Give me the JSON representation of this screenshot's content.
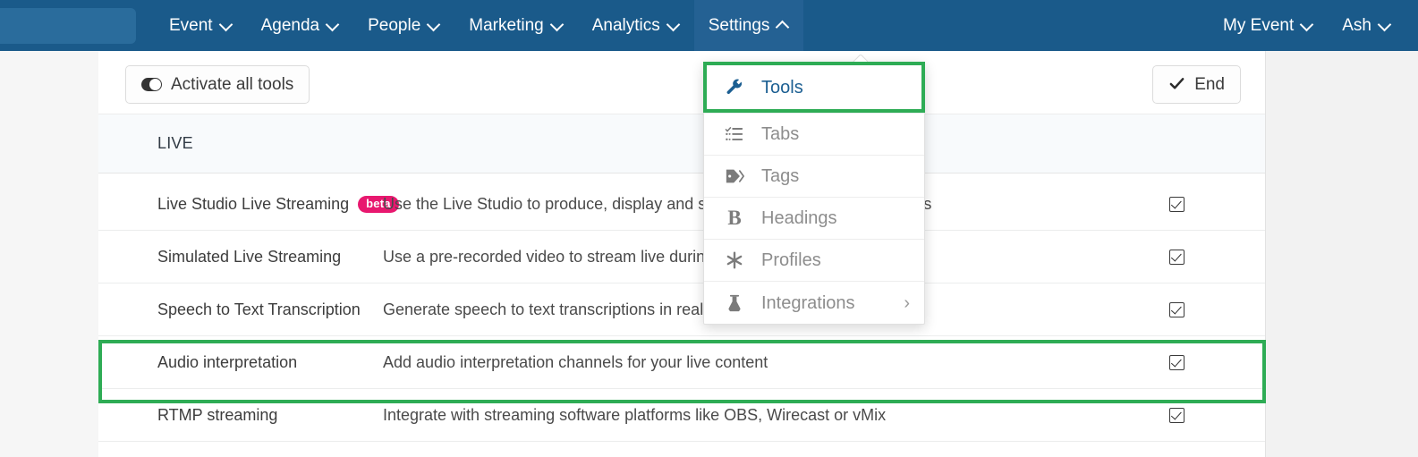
{
  "navbar": {
    "search_placeholder": "",
    "items": [
      {
        "label": "Event",
        "icon": "chevron-down-icon",
        "active": false
      },
      {
        "label": "Agenda",
        "icon": "chevron-down-icon",
        "active": false
      },
      {
        "label": "People",
        "icon": "chevron-down-icon",
        "active": false
      },
      {
        "label": "Marketing",
        "icon": "chevron-down-icon",
        "active": false
      },
      {
        "label": "Analytics",
        "icon": "chevron-down-icon",
        "active": false
      },
      {
        "label": "Settings",
        "icon": "chevron-up-icon",
        "active": true
      }
    ],
    "right_items": [
      {
        "label": "My Event",
        "icon": "chevron-down-icon"
      },
      {
        "label": "Ash",
        "icon": "chevron-down-icon"
      }
    ],
    "background_color": "#1a5a8a",
    "active_tab_color": "#246193"
  },
  "dropdown": {
    "items": [
      {
        "label": "Tools",
        "icon": "wrench-icon",
        "highlighted": true,
        "has_submenu": false
      },
      {
        "label": "Tabs",
        "icon": "list-icon",
        "highlighted": false,
        "has_submenu": false
      },
      {
        "label": "Tags",
        "icon": "tag-icon",
        "highlighted": false,
        "has_submenu": false
      },
      {
        "label": "Headings",
        "icon": "bold-b-icon",
        "highlighted": false,
        "has_submenu": false
      },
      {
        "label": "Profiles",
        "icon": "asterisk-icon",
        "highlighted": false,
        "has_submenu": false
      },
      {
        "label": "Integrations",
        "icon": "flask-icon",
        "highlighted": false,
        "has_submenu": true,
        "submenu_chevron": "›"
      }
    ]
  },
  "toolbar": {
    "activate_all_label": "Activate all tools",
    "activate_all_icon": "toggle-switch-icon",
    "end_label": "End",
    "end_icon": "checkmark-icon"
  },
  "clipped_text": "",
  "section": {
    "title": "LIVE"
  },
  "table": {
    "rows": [
      {
        "name": "Live Studio Live Streaming",
        "badge": "beta",
        "description": "Use the Live Studio to produce, display and stream live content for attendees",
        "enabled": true,
        "highlighted": false
      },
      {
        "name": "Simulated Live Streaming",
        "badge": "",
        "description": "Use a pre-recorded video to stream live during your event automatically",
        "enabled": true,
        "highlighted": false
      },
      {
        "name": "Speech to Text Transcription",
        "badge": "",
        "description": "Generate speech to text transcriptions in real time for attendees",
        "enabled": true,
        "highlighted": false
      },
      {
        "name": "Audio interpretation",
        "badge": "",
        "description": "Add audio interpretation channels for your live content",
        "enabled": true,
        "highlighted": true
      },
      {
        "name": "RTMP streaming",
        "badge": "",
        "description": "Integrate with streaming software platforms like OBS, Wirecast or vMix",
        "enabled": true,
        "highlighted": false
      }
    ]
  },
  "colors": {
    "highlight_green": "#2eac55",
    "badge_pink": "#e8186f",
    "nav_blue": "#1a5a8a",
    "link_blue": "#1c5f92"
  }
}
